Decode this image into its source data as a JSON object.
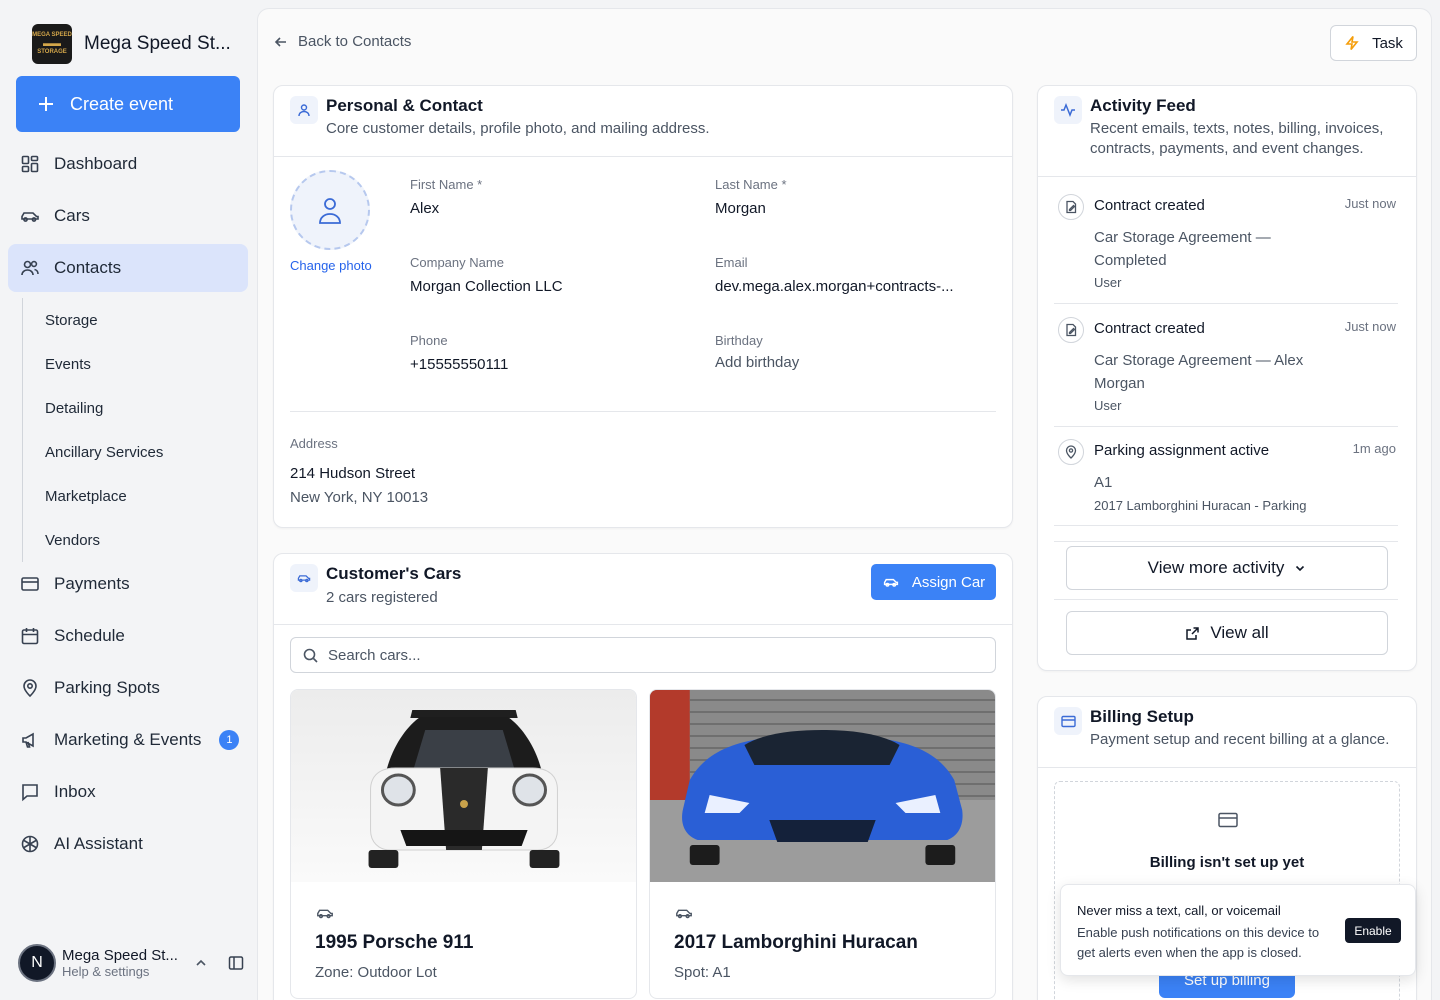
{
  "brand": {
    "name": "Mega Speed St...",
    "logo_text_top": "MEGA SPEED",
    "logo_text_bottom": "STORAGE"
  },
  "sidebar": {
    "create_label": "Create event",
    "items": [
      {
        "label": "Dashboard",
        "icon": "dashboard-icon"
      },
      {
        "label": "Cars",
        "icon": "car-icon"
      },
      {
        "label": "Contacts",
        "icon": "users-icon",
        "active": true
      },
      {
        "label": "Payments",
        "icon": "credit-card-icon"
      },
      {
        "label": "Schedule",
        "icon": "calendar-icon"
      },
      {
        "label": "Parking Spots",
        "icon": "map-pin-icon"
      },
      {
        "label": "Marketing & Events",
        "icon": "megaphone-icon",
        "badge": "1"
      },
      {
        "label": "Inbox",
        "icon": "message-icon"
      },
      {
        "label": "AI Assistant",
        "icon": "ai-icon"
      }
    ],
    "sub_items": [
      "Storage",
      "Events",
      "Detailing",
      "Ancillary Services",
      "Marketplace",
      "Vendors"
    ],
    "user": {
      "initial": "N",
      "name": "Mega Speed St...",
      "sub": "Help & settings"
    }
  },
  "header": {
    "back_label": "Back to Contacts",
    "task_label": "Task"
  },
  "personal": {
    "title": "Personal & Contact",
    "subtitle": "Core customer details, profile photo, and mailing address.",
    "change_photo": "Change photo",
    "first_name_label": "First Name *",
    "first_name": "Alex",
    "last_name_label": "Last Name *",
    "last_name": "Morgan",
    "company_label": "Company Name",
    "company": "Morgan Collection LLC",
    "email_label": "Email",
    "email": "dev.mega.alex.morgan+contracts-...",
    "phone_label": "Phone",
    "phone": "+15555550111",
    "birthday_label": "Birthday",
    "birthday": "Add birthday",
    "address_label": "Address",
    "address_line1": "214 Hudson Street",
    "address_line2": "New York, NY 10013"
  },
  "cars": {
    "title": "Customer's Cars",
    "subtitle": "2 cars registered",
    "assign_label": "Assign Car",
    "search_placeholder": "Search cars...",
    "items": [
      {
        "name": "1995 Porsche 911",
        "location": "Zone: Outdoor Lot",
        "color": "#f4f4f4"
      },
      {
        "name": "2017 Lamborghini Huracan",
        "location": "Spot: A1",
        "color": "#2f5fd0"
      }
    ]
  },
  "activity": {
    "title": "Activity Feed",
    "subtitle": "Recent emails, texts, notes, billing, invoices, contracts, payments, and event changes.",
    "items": [
      {
        "title": "Contract created",
        "time": "Just now",
        "desc": "Car Storage Agreement — Completed",
        "meta": "User"
      },
      {
        "title": "Contract created",
        "time": "Just now",
        "desc": "Car Storage Agreement — Alex Morgan",
        "meta": "User"
      },
      {
        "title": "Parking assignment active",
        "time": "1m ago",
        "desc": "A1",
        "meta": "2017 Lamborghini Huracan - Parking"
      }
    ],
    "view_more_label": "View more activity",
    "view_all_label": "View all"
  },
  "billing": {
    "title": "Billing Setup",
    "subtitle": "Payment setup and recent billing at a glance.",
    "empty_title": "Billing isn't set up yet",
    "setup_label": "Set up billing"
  },
  "toast": {
    "title": "Never miss a text, call, or voicemail",
    "body": "Enable push notifications on this device to get alerts even when the app is closed.",
    "enable_label": "Enable"
  },
  "colors": {
    "accent": "#3b82f6",
    "active_nav": "#dbe4fb",
    "text": "#111827"
  }
}
